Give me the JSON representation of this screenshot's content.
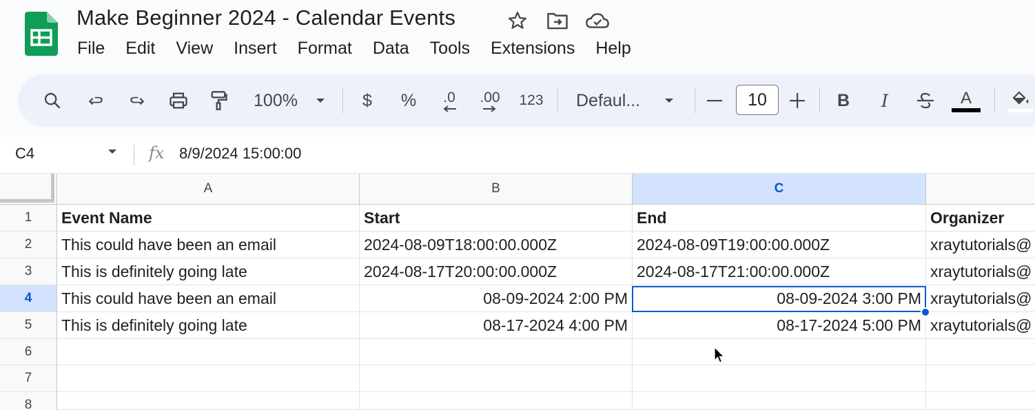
{
  "app": {
    "title": "Make Beginner 2024 - Calendar Events",
    "title_icons": [
      "star-icon",
      "move-to-folder-icon",
      "cloud-saved-icon"
    ]
  },
  "menu": [
    "File",
    "Edit",
    "View",
    "Insert",
    "Format",
    "Data",
    "Tools",
    "Extensions",
    "Help"
  ],
  "toolbar": {
    "zoom": "100%",
    "currency": "$",
    "percent": "%",
    "decrease_decimal": ".0",
    "increase_decimal": ".00",
    "number_format": "123",
    "font": "Defaul...",
    "font_size": "10",
    "bold": "B",
    "italic": "I",
    "text_color_letter": "A"
  },
  "formula_bar": {
    "cell_ref": "C4",
    "fx": "fx",
    "value": "8/9/2024 15:00:00"
  },
  "grid": {
    "columns": [
      "A",
      "B",
      "C"
    ],
    "rows": [
      "1",
      "2",
      "3",
      "4",
      "5",
      "6",
      "7",
      "8"
    ],
    "cells": [
      [
        "Event Name",
        "Start",
        "End",
        "Organizer"
      ],
      [
        "This could have been an email",
        "2024-08-09T18:00:00.000Z",
        "2024-08-09T19:00:00.000Z",
        "xraytutorials@"
      ],
      [
        "This is definitely going late",
        "2024-08-17T20:00:00.000Z",
        "2024-08-17T21:00:00.000Z",
        "xraytutorials@"
      ],
      [
        "This could have been an email",
        "08-09-2024 2:00 PM",
        "08-09-2024 3:00 PM",
        "xraytutorials@"
      ],
      [
        "This is definitely going late",
        "08-17-2024 4:00 PM",
        "08-17-2024 5:00 PM",
        "xraytutorials@"
      ]
    ],
    "selected_cell": "C4"
  },
  "colors": {
    "accent": "#0b57d0",
    "selection_header": "#d3e3fd",
    "toolbar_bg": "#edf2fa",
    "sheets_green": "#0f9d58"
  }
}
